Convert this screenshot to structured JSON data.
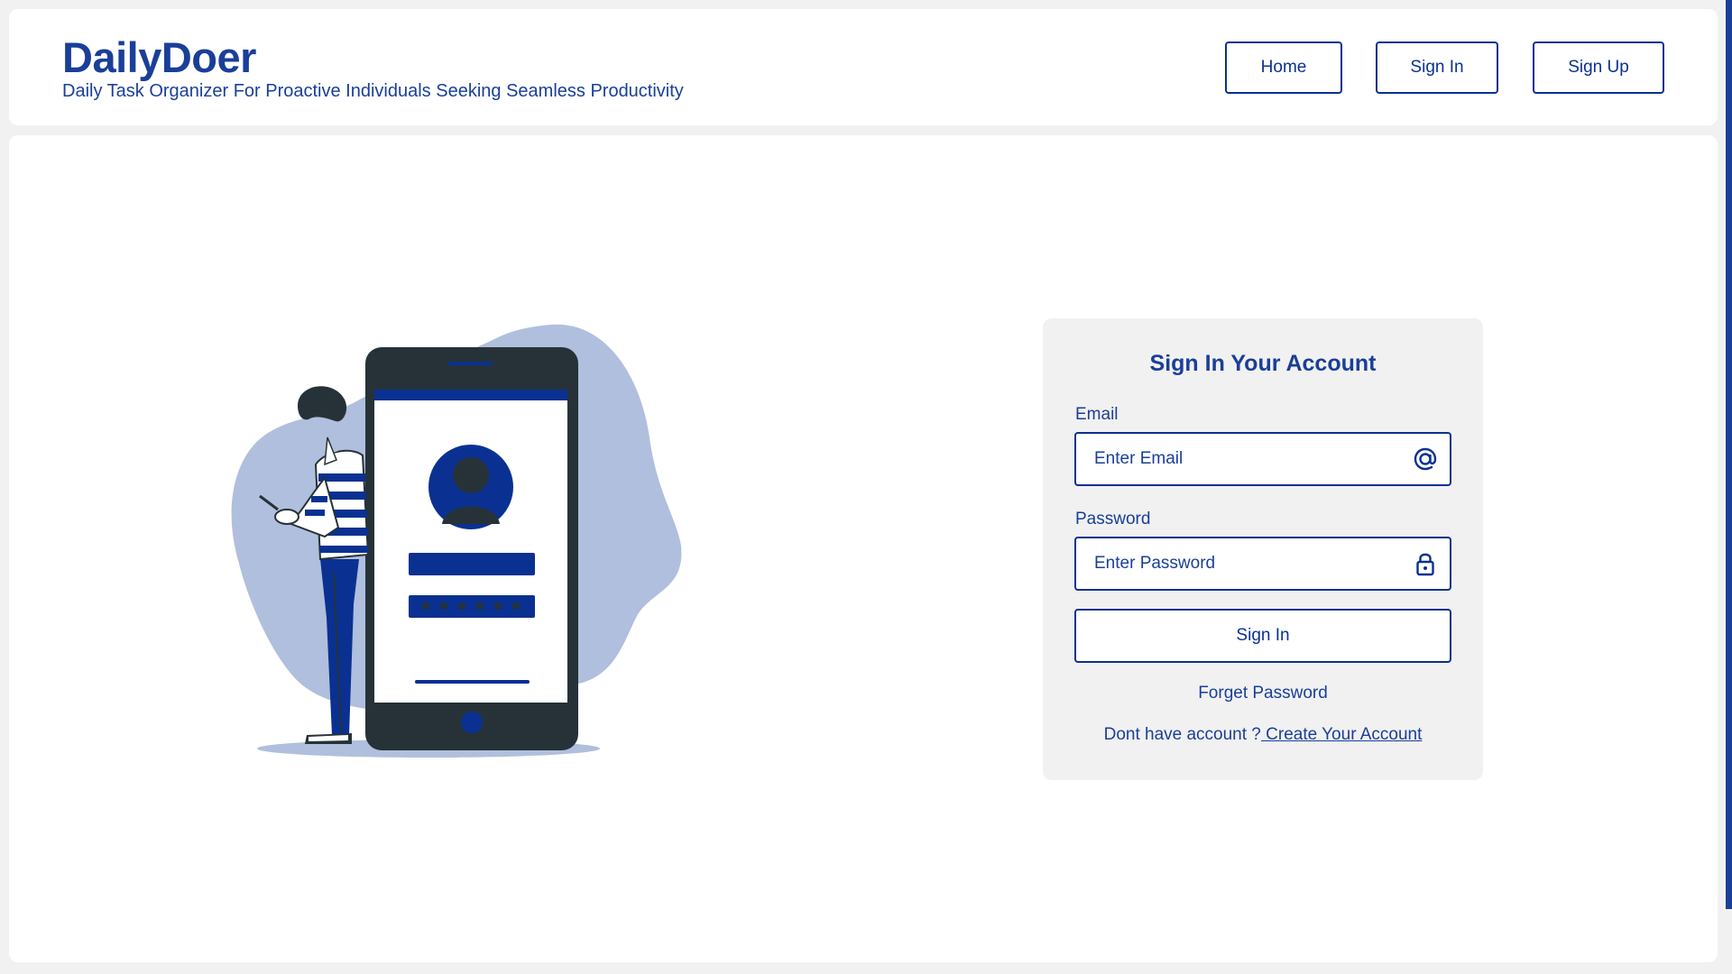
{
  "header": {
    "title": "DailyDoer",
    "tagline": "Daily Task Organizer For Proactive Individuals Seeking Seamless Productivity",
    "nav": {
      "home": "Home",
      "sign_in": "Sign In",
      "sign_up": "Sign Up"
    }
  },
  "login_card": {
    "title": "Sign In Your Account",
    "email": {
      "label": "Email",
      "placeholder": "Enter Email",
      "value": "",
      "icon": "at-sign-icon"
    },
    "password": {
      "label": "Password",
      "placeholder": "Enter Password",
      "value": "",
      "icon": "lock-icon"
    },
    "submit_label": "Sign In",
    "forgot_label": "Forget Password",
    "signup_prompt": "Dont have account ?",
    "signup_link": " Create Your Account"
  },
  "illustration": {
    "icon": "person-using-phone-login-illustration"
  },
  "colors": {
    "brand": "#1a3f99",
    "accent": "#0a3191",
    "blob": "#b0bfdd",
    "phone": "#263238",
    "background": "#f1f1f1",
    "card": "#f1f1f1"
  }
}
